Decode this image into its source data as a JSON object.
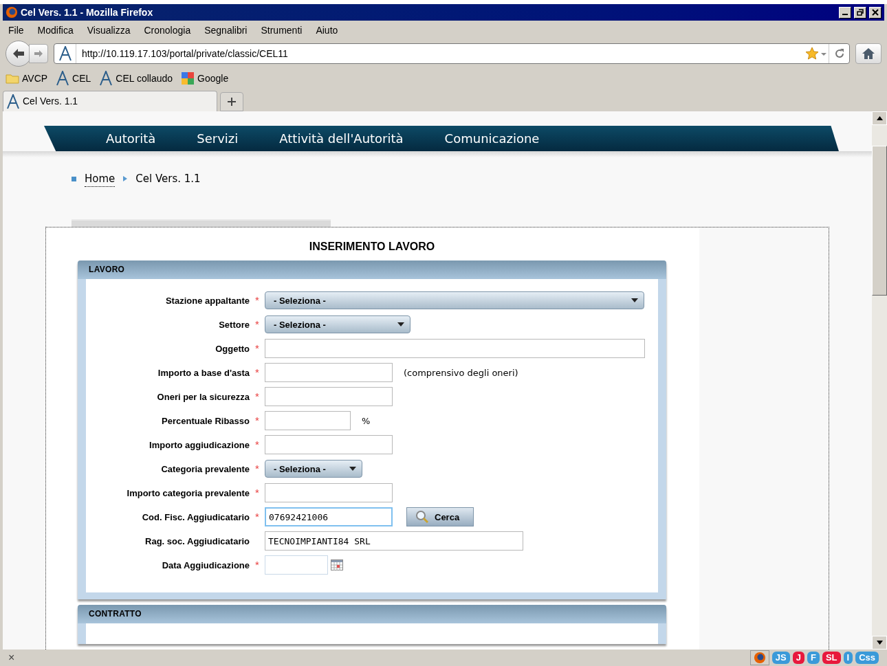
{
  "window": {
    "title": "Cel Vers. 1.1 - Mozilla Firefox"
  },
  "menu": [
    "File",
    "Modifica",
    "Visualizza",
    "Cronologia",
    "Segnalibri",
    "Strumenti",
    "Aiuto"
  ],
  "address": {
    "url": "http://10.119.17.103/portal/private/classic/CEL11"
  },
  "bookmarks": [
    {
      "label": "AVCP",
      "kind": "folder"
    },
    {
      "label": "CEL",
      "kind": "site"
    },
    {
      "label": "CEL collaudo",
      "kind": "site"
    },
    {
      "label": "Google",
      "kind": "google"
    }
  ],
  "tabs": [
    {
      "label": "Cel Vers. 1.1",
      "selected": true
    }
  ],
  "nav": [
    "Autorità",
    "Servizi",
    "Attività dell'Autorità",
    "Comunicazione"
  ],
  "breadcrumb": [
    {
      "label": "Home",
      "link": true
    },
    {
      "label": "Cel Vers. 1.1",
      "link": false
    }
  ],
  "page_title": "INSERIMENTO LAVORO",
  "sections": [
    {
      "title": "LAVORO",
      "fields": [
        {
          "label": "Stazione appaltante",
          "required": "*",
          "kind": "select",
          "value": "- Seleziona -"
        },
        {
          "label": "Settore",
          "required": "*",
          "kind": "select",
          "value": "- Seleziona -"
        },
        {
          "label": "Oggetto",
          "required": "*",
          "kind": "input"
        },
        {
          "label": "Importo a base d'asta",
          "required": "*",
          "kind": "input",
          "suffix": "(comprensivo degli oneri)"
        },
        {
          "label": "Oneri per la sicurezza",
          "required": "*",
          "kind": "input"
        },
        {
          "label": "Percentuale Ribasso",
          "required": "*",
          "kind": "input",
          "suffix": "%"
        },
        {
          "label": "Importo aggiudicazione",
          "required": "*",
          "kind": "input"
        },
        {
          "label": "Categoria prevalente",
          "required": "*",
          "kind": "select",
          "value": "- Seleziona -"
        },
        {
          "label": "Importo categoria prevalente",
          "required": "*",
          "kind": "input"
        },
        {
          "label": "Cod. Fisc. Aggiudicatario",
          "required": "*",
          "kind": "input",
          "value": "07692421006",
          "focused": true,
          "button": "Cerca"
        },
        {
          "label": "Rag. soc. Aggiudicatario",
          "kind": "input",
          "value": "TECNOIMPIANTI84 SRL"
        },
        {
          "label": "Data Aggiudicazione",
          "required": "*",
          "kind": "date"
        }
      ]
    },
    {
      "title": "CONTRATTO"
    }
  ],
  "status_bar": {
    "close": "×",
    "addons": [
      {
        "label": "JS",
        "color": "#3a9ad9"
      },
      {
        "label": "J",
        "color": "#e8193c"
      },
      {
        "label": "F",
        "color": "#3a9ad9"
      },
      {
        "label": "SL",
        "color": "#e8193c"
      },
      {
        "label": "I",
        "color": "#3a9ad9"
      },
      {
        "label": "Css",
        "color": "#3a9ad9"
      }
    ]
  }
}
